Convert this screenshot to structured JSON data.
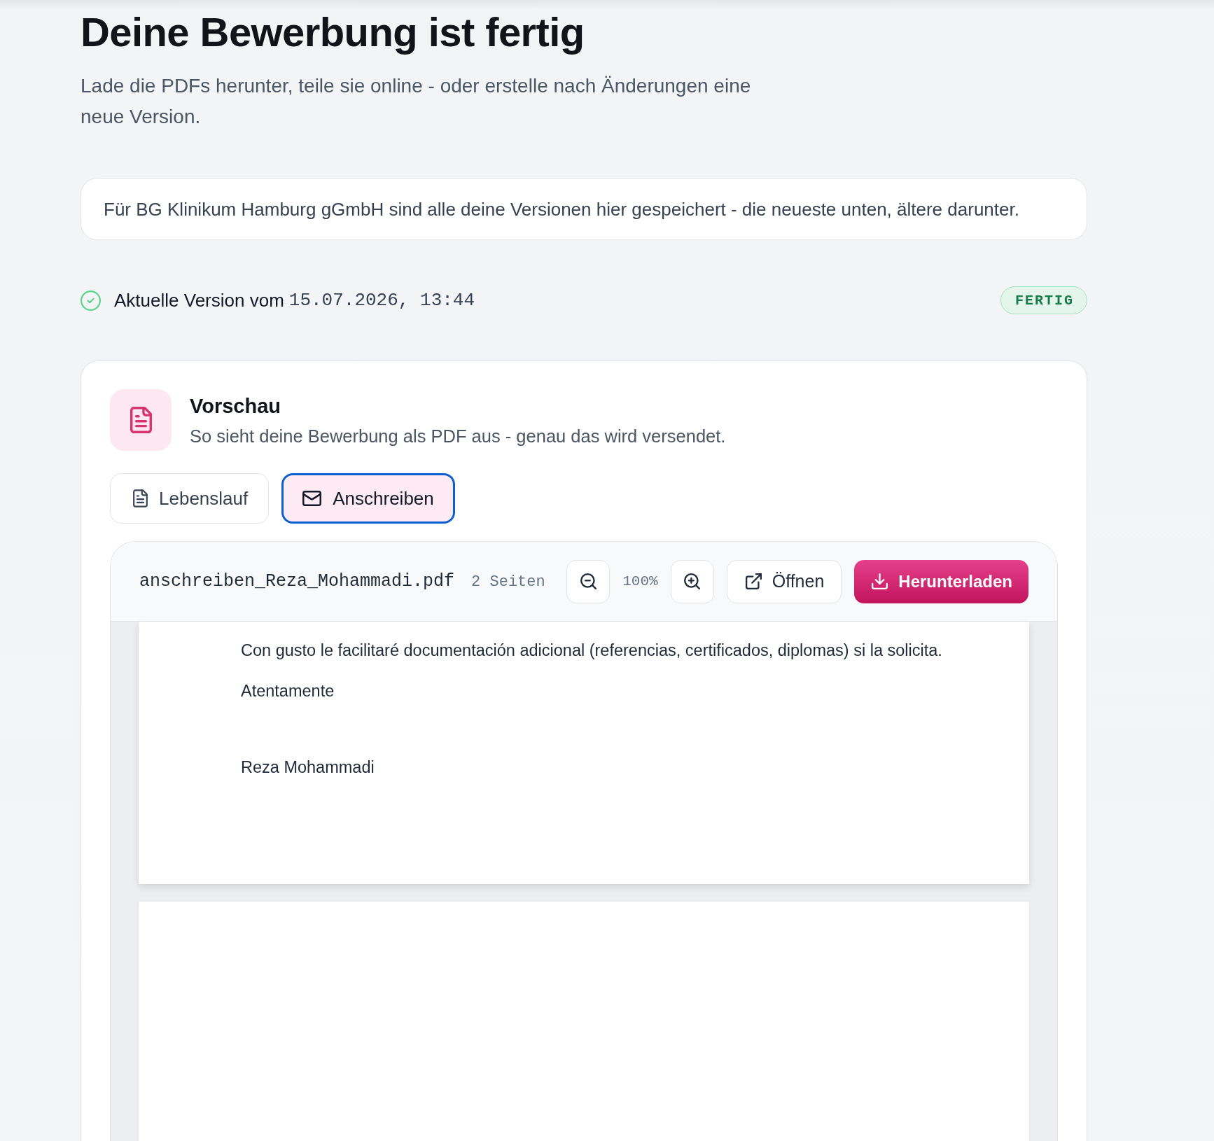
{
  "header": {
    "title": "Deine Bewerbung ist fertig",
    "subtitle": "Lade die PDFs herunter, teile sie online - oder erstelle nach Änderungen eine neue Version."
  },
  "info": {
    "text": "Für BG Klinikum Hamburg gGmbH sind alle deine Versionen hier gespeichert - die neueste unten, ältere darunter."
  },
  "version": {
    "label": "Aktuelle Version vom",
    "timestamp": "15.07.2026, 13:44",
    "status": "FERTIG"
  },
  "preview": {
    "title": "Vorschau",
    "subtitle": "So sieht deine Bewerbung als PDF aus - genau das wird versendet.",
    "tabs": [
      {
        "label": "Lebenslauf",
        "kind": "cv",
        "selected": false
      },
      {
        "label": "Anschreiben",
        "kind": "letter",
        "selected": true
      }
    ],
    "viewer": {
      "filename": "anschreiben_Reza_Mohammadi.pdf",
      "page_count": "2 Seiten",
      "zoom": "100%",
      "actions": [
        {
          "label": "Öffnen",
          "kind": "open"
        },
        {
          "label": "Herunterladen",
          "kind": "download"
        }
      ],
      "paragraphs": [
        {
          "text": "Con gusto le facilitaré documentación adicional (referencias, certificados, diplomas) si la solicita.",
          "kind": "body"
        },
        {
          "text": "Atentamente",
          "kind": "closing"
        },
        {
          "text": "Reza Mohammadi",
          "kind": "signature"
        }
      ]
    }
  }
}
